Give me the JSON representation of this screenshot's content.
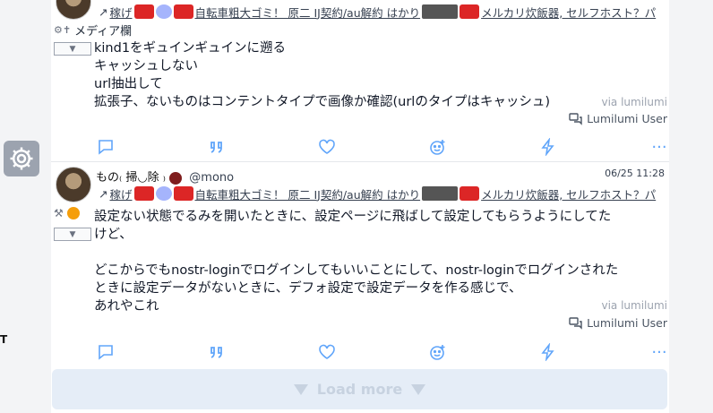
{
  "sidebar": {
    "settings_icon": "gear-icon",
    "edge_mark": "T"
  },
  "posts": [
    {
      "strip": {
        "repost_mark": "↗",
        "text_a": "稼げ",
        "text_b": "自転車粗大ゴミ！ 原二 IJ契約/au解約 はかり",
        "text_c": "メルカリ炊飯器, セルフホスト？パ"
      },
      "cw_icon_text": "",
      "cw_label": "メディア欄",
      "content": [
        "kind1をギュインギュインに遡る",
        "キャッシュしない",
        "url抽出して",
        "拡張子、ないものはコンテントタイプで画像か確認(urlのタイプはキャッシュ)"
      ],
      "via": "via lumilumi",
      "user_chip": "Lumilumi User"
    },
    {
      "author_name": "もの₍ 掃◡除 ₎",
      "author_handle": "@mono",
      "time": "06/25 11:28",
      "strip": {
        "repost_mark": "↗",
        "text_a": "稼げ",
        "text_b": "自転車粗大ゴミ！ 原二 IJ契約/au解約 はかり",
        "text_c": "メルカリ炊飯器, セルフホスト？パ"
      },
      "content": [
        "設定ない状態でるみを開いたときに、設定ページに飛ばして設定してもらうようにしてた",
        "けど、",
        "",
        "どこからでもnostr-loginでログインしてもいいことにして、nostr-loginでログインされた",
        "ときに設定データがないときに、デフォ設定で設定データを作る感じで、",
        "あれやこれ"
      ],
      "via": "via lumilumi",
      "user_chip": "Lumilumi User"
    }
  ],
  "actions": [
    "reply-icon",
    "quote-icon",
    "like-icon",
    "reaction-icon",
    "zap-icon",
    "more-icon"
  ],
  "action_more_glyph": "···",
  "load_more": "Load more"
}
